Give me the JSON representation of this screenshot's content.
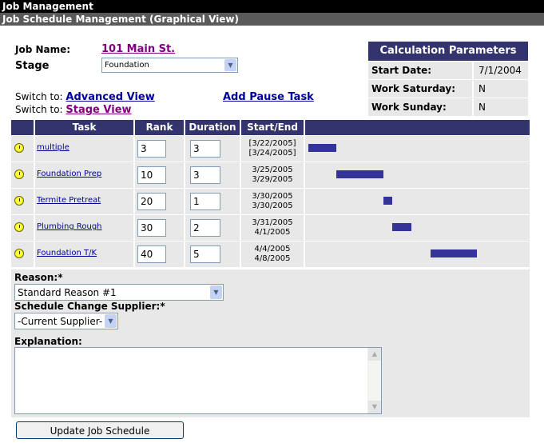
{
  "header": {
    "title": "Job Management",
    "subtitle": "Job Schedule Management (Graphical View)"
  },
  "job": {
    "name_label": "Job Name:",
    "name_value": "101 Main St.",
    "stage_label": "Stage",
    "stage_value": "Foundation"
  },
  "switch": {
    "label1": "Switch to:",
    "advanced": "Advanced View",
    "label2": "Switch to:",
    "stage": "Stage View",
    "add_pause": "Add Pause Task"
  },
  "calc": {
    "title": "Calculation Parameters",
    "rows": [
      {
        "k": "Start Date:",
        "v": "7/1/2004"
      },
      {
        "k": "Work Saturday:",
        "v": "N"
      },
      {
        "k": "Work Sunday:",
        "v": "N"
      }
    ]
  },
  "grid": {
    "headers": {
      "task": "Task",
      "rank": "Rank",
      "duration": "Duration",
      "startend": "Start/End"
    },
    "rows": [
      {
        "task": "multiple",
        "rank": "3",
        "duration": "3",
        "start": "[3/22/2005]",
        "end": "[3/24/2005]",
        "bar_start": 0.0,
        "bar_len": 0.125
      },
      {
        "task": "Foundation Prep",
        "rank": "10",
        "duration": "3",
        "start": "3/25/2005",
        "end": "3/29/2005",
        "bar_start": 0.125,
        "bar_len": 0.21
      },
      {
        "task": "Termite Pretreat",
        "rank": "20",
        "duration": "1",
        "start": "3/30/2005",
        "end": "3/30/2005",
        "bar_start": 0.335,
        "bar_len": 0.04
      },
      {
        "task": "Plumbing Rough",
        "rank": "30",
        "duration": "2",
        "start": "3/31/2005",
        "end": "4/1/2005",
        "bar_start": 0.375,
        "bar_len": 0.085
      },
      {
        "task": "Foundation T/K",
        "rank": "40",
        "duration": "5",
        "start": "4/4/2005",
        "end": "4/8/2005",
        "bar_start": 0.545,
        "bar_len": 0.21
      }
    ]
  },
  "form": {
    "reason_label": "Reason:*",
    "reason_value": "Standard Reason #1",
    "supplier_label": "Schedule Change Supplier:*",
    "supplier_value": "-Current Supplier-",
    "explanation_label": "Explanation:",
    "update_button": "Update Job Schedule"
  },
  "colors": {
    "header_bg": "#33336d",
    "bar": "#333399",
    "row_bg": "#e8e8e8",
    "link": "#000099",
    "visited_link": "#800080"
  }
}
